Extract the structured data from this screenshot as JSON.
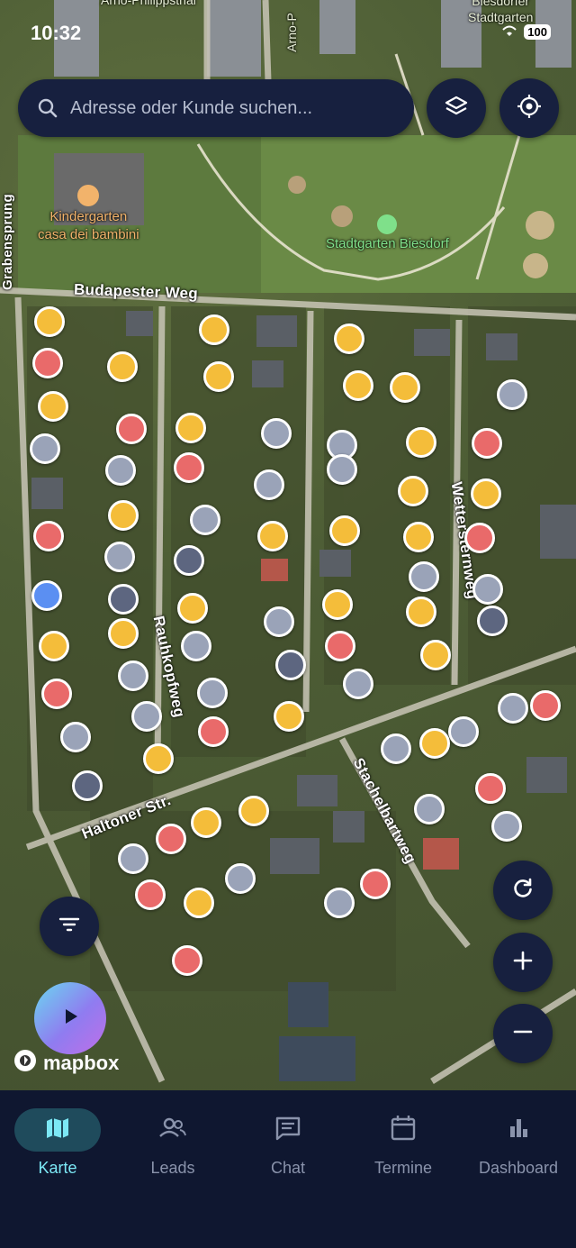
{
  "status_bar": {
    "time": "10:32",
    "battery": "100"
  },
  "search": {
    "placeholder": "Adresse oder Kunde suchen..."
  },
  "map": {
    "labels": {
      "kindergarten": "Kindergarten\ncasa dei bambini",
      "park": "Stadtgarten Biesdorf",
      "budapester": "Budapester Weg",
      "rauhkopfweg": "Rauhkopfweg",
      "wettersternweg": "Wettersternweg",
      "haltoner": "Haltoner Str.",
      "stachelbartweg": "Stachelbartweg",
      "grabensprung": "Grabensprung",
      "top_left": "Arno-Philippsthal",
      "top_right": "Biesdorfer\nStadtgarten",
      "arno": "Arno-P"
    },
    "pin_colors": {
      "yellow": "#f4bd3a",
      "red": "#e96a6a",
      "gray": "#9aa3b8",
      "dark": "#5d6680",
      "blue": "#5b8ff2"
    }
  },
  "attribution": "mapbox",
  "nav": {
    "items": [
      {
        "label": "Karte",
        "icon": "map-icon",
        "active": true
      },
      {
        "label": "Leads",
        "icon": "people-icon",
        "active": false
      },
      {
        "label": "Chat",
        "icon": "chat-icon",
        "active": false
      },
      {
        "label": "Termine",
        "icon": "calendar-icon",
        "active": false
      },
      {
        "label": "Dashboard",
        "icon": "bar-chart-icon",
        "active": false
      }
    ]
  }
}
